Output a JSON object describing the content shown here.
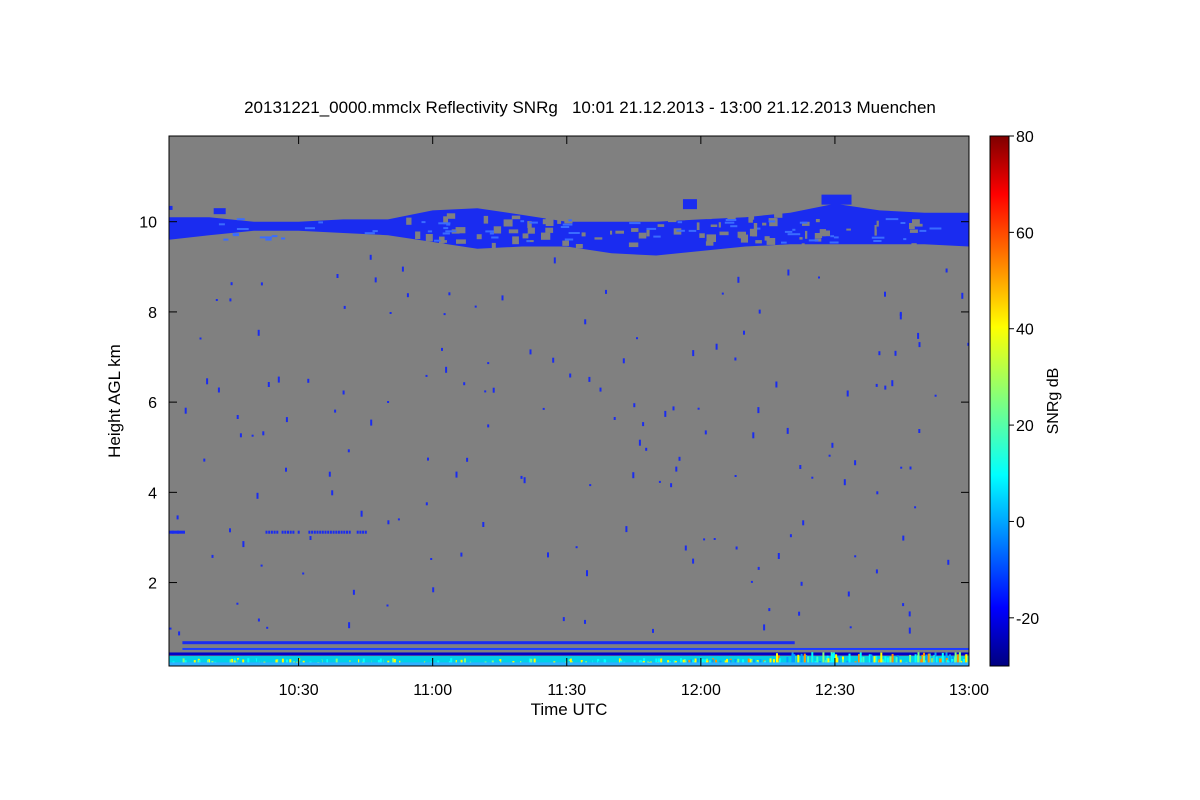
{
  "chart_data": {
    "type": "heatmap",
    "title": "20131221_0000.mmclx Reflectivity SNRg   10:01 21.12.2013 - 13:00 21.12.2013 Muenchen",
    "xlabel": "Time UTC",
    "ylabel": "Height AGL km",
    "x_range_minutes_utc": [
      601,
      780
    ],
    "y_range_km": [
      0.15,
      11.9
    ],
    "x_ticks": [
      {
        "label": "10:30",
        "value": 630
      },
      {
        "label": "11:00",
        "value": 660
      },
      {
        "label": "11:30",
        "value": 690
      },
      {
        "label": "12:00",
        "value": 720
      },
      {
        "label": "12:30",
        "value": 750
      },
      {
        "label": "13:00",
        "value": 780
      }
    ],
    "y_ticks": [
      2,
      4,
      6,
      8,
      10
    ],
    "background_color": "#808080",
    "colorbar": {
      "label": "SNRg dB",
      "range": [
        -30,
        80
      ],
      "ticks": [
        -20,
        0,
        20,
        40,
        60,
        80
      ],
      "colormap": "jet"
    },
    "features": {
      "cirrus_layer": {
        "snr_db": -22,
        "color": "#1a2cf0",
        "profile": [
          {
            "t": 601,
            "bottom": 9.6,
            "top": 10.1
          },
          {
            "t": 610,
            "bottom": 9.7,
            "top": 10.1
          },
          {
            "t": 620,
            "bottom": 9.8,
            "top": 10.0
          },
          {
            "t": 630,
            "bottom": 9.8,
            "top": 10.0
          },
          {
            "t": 640,
            "bottom": 9.75,
            "top": 10.05
          },
          {
            "t": 650,
            "bottom": 9.7,
            "top": 10.05
          },
          {
            "t": 660,
            "bottom": 9.55,
            "top": 10.25
          },
          {
            "t": 670,
            "bottom": 9.4,
            "top": 10.3
          },
          {
            "t": 680,
            "bottom": 9.45,
            "top": 10.15
          },
          {
            "t": 690,
            "bottom": 9.45,
            "top": 10.0
          },
          {
            "t": 700,
            "bottom": 9.3,
            "top": 10.0
          },
          {
            "t": 710,
            "bottom": 9.25,
            "top": 10.0
          },
          {
            "t": 720,
            "bottom": 9.35,
            "top": 10.05
          },
          {
            "t": 730,
            "bottom": 9.45,
            "top": 10.1
          },
          {
            "t": 740,
            "bottom": 9.5,
            "top": 10.2
          },
          {
            "t": 750,
            "bottom": 9.5,
            "top": 10.4
          },
          {
            "t": 760,
            "bottom": 9.5,
            "top": 10.25
          },
          {
            "t": 770,
            "bottom": 9.5,
            "top": 10.2
          },
          {
            "t": 780,
            "bottom": 9.45,
            "top": 10.2
          }
        ]
      },
      "noise_band_km": 3.15,
      "ground_clutter_top_km": 0.7
    }
  }
}
